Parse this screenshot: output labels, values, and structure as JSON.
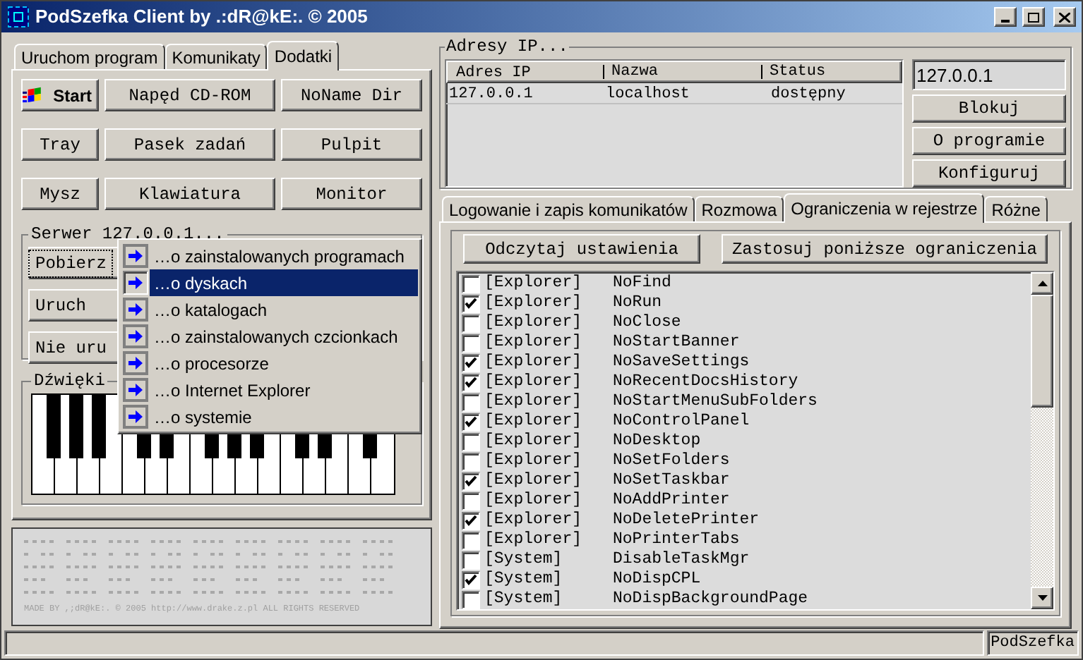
{
  "window": {
    "title": "PodSzefka Client by .:dR@kE:. © 2005"
  },
  "left_tabs": [
    {
      "label": "Uruchom program",
      "selected": false
    },
    {
      "label": "Komunikaty",
      "selected": false
    },
    {
      "label": "Dodatki",
      "selected": true
    }
  ],
  "tool_buttons": [
    {
      "label": "Start",
      "kind": "start"
    },
    {
      "label": "Napęd CD-ROM",
      "kind": "plain"
    },
    {
      "label": "NoName Dir",
      "kind": "plain"
    },
    {
      "label": "Tray",
      "kind": "plain"
    },
    {
      "label": "Pasek zadań",
      "kind": "plain"
    },
    {
      "label": "Pulpit",
      "kind": "plain"
    },
    {
      "label": "Mysz",
      "kind": "plain"
    },
    {
      "label": "Klawiatura",
      "kind": "plain"
    },
    {
      "label": "Monitor",
      "kind": "plain"
    }
  ],
  "server_group": {
    "title": "Serwer 127.0.0.1...",
    "buttons": [
      {
        "label": "Pobierz",
        "focused": true
      },
      {
        "label": "Uruch",
        "focused": false
      },
      {
        "label": "Nie uru",
        "focused": false
      }
    ]
  },
  "context_menu": {
    "items": [
      {
        "label": "…o zainstalowanych programach",
        "selected": false
      },
      {
        "label": "…o dyskach",
        "selected": true
      },
      {
        "label": "…o katalogach",
        "selected": false
      },
      {
        "label": "…o zainstalowanych czcionkach",
        "selected": false
      },
      {
        "label": "…o procesorze",
        "selected": false
      },
      {
        "label": "…o Internet Explorer",
        "selected": false
      },
      {
        "label": "…o systemie",
        "selected": false
      }
    ]
  },
  "sound_group": {
    "title": "Dźwięki"
  },
  "credits": "MADE BY ,;dR@kE:. © 2005 http://www.drake.z.pl ALL RIGHTS RESERVED",
  "ip_group": {
    "title": "Adresy IP...",
    "columns": [
      "Adres IP",
      "Nazwa",
      "Status"
    ],
    "rows": [
      {
        "cells": [
          "127.0.0.1",
          "localhost",
          "dostępny"
        ]
      }
    ],
    "address_field": {
      "value": "127.0.0.1"
    },
    "buttons": [
      "Blokuj",
      "O programie",
      "Konfiguruj"
    ]
  },
  "right_tabs": [
    {
      "label": "Logowanie i zapis komunikatów",
      "selected": false
    },
    {
      "label": "Rozmowa",
      "selected": false
    },
    {
      "label": "Ograniczenia w rejestrze",
      "selected": true
    },
    {
      "label": "Różne",
      "selected": false
    }
  ],
  "registry": {
    "buttons": [
      "Odczytaj ustawienia",
      "Zastosuj poniższe ograniczenia"
    ],
    "items": [
      {
        "section": "[Explorer]",
        "value": "NoFind",
        "checked": false
      },
      {
        "section": "[Explorer]",
        "value": "NoRun",
        "checked": true
      },
      {
        "section": "[Explorer]",
        "value": "NoClose",
        "checked": false
      },
      {
        "section": "[Explorer]",
        "value": "NoStartBanner",
        "checked": false
      },
      {
        "section": "[Explorer]",
        "value": "NoSaveSettings",
        "checked": true
      },
      {
        "section": "[Explorer]",
        "value": "NoRecentDocsHistory",
        "checked": true
      },
      {
        "section": "[Explorer]",
        "value": "NoStartMenuSubFolders",
        "checked": false
      },
      {
        "section": "[Explorer]",
        "value": "NoControlPanel",
        "checked": true
      },
      {
        "section": "[Explorer]",
        "value": "NoDesktop",
        "checked": false
      },
      {
        "section": "[Explorer]",
        "value": "NoSetFolders",
        "checked": false
      },
      {
        "section": "[Explorer]",
        "value": "NoSetTaskbar",
        "checked": true
      },
      {
        "section": "[Explorer]",
        "value": "NoAddPrinter",
        "checked": false
      },
      {
        "section": "[Explorer]",
        "value": "NoDeletePrinter",
        "checked": true
      },
      {
        "section": "[Explorer]",
        "value": "NoPrinterTabs",
        "checked": false
      },
      {
        "section": "[System]",
        "value": "DisableTaskMgr",
        "checked": false
      },
      {
        "section": "[System]",
        "value": "NoDispCPL",
        "checked": true
      },
      {
        "section": "[System]",
        "value": "NoDispBackgroundPage",
        "checked": false
      }
    ]
  },
  "status_bar": {
    "panel": "PodSzefka"
  }
}
